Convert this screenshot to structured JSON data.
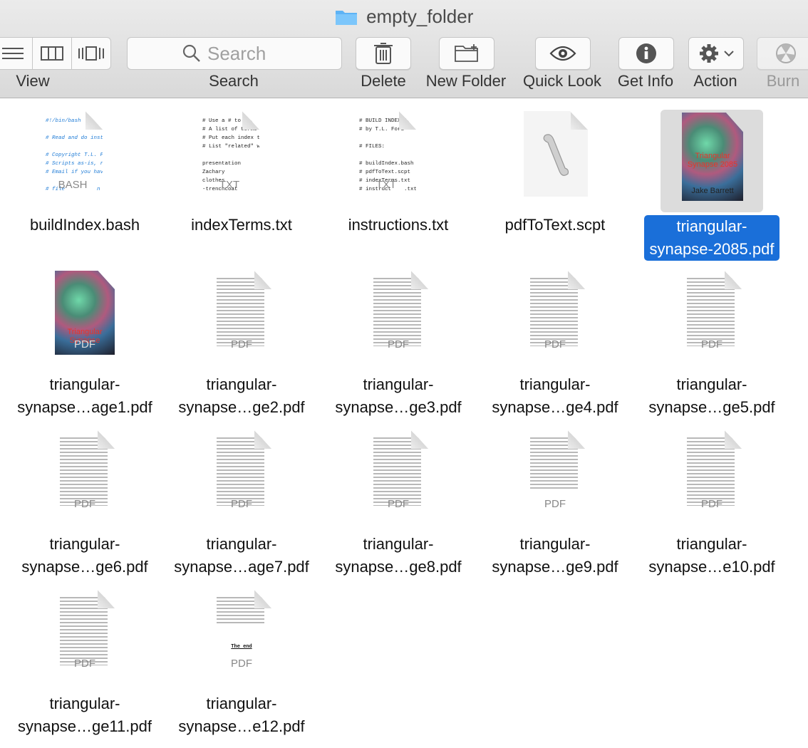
{
  "window": {
    "title": "empty_folder"
  },
  "toolbar": {
    "view_label": "View",
    "search_label": "Search",
    "search_placeholder": "Search",
    "delete_label": "Delete",
    "new_folder_label": "New Folder",
    "quick_look_label": "Quick Look",
    "get_info_label": "Get Info",
    "action_label": "Action",
    "burn_label": "Burn"
  },
  "files": [
    {
      "name": "buildIndex.bash",
      "ext": "BASH",
      "kind": "code",
      "preview": "#!/bin/bash\n\n# Read and do instruct\n\n# Copyright T.L. Ford,\n# Scripts as-is, run a\n# Email if you have sug\n\n# file          n term"
    },
    {
      "name": "indexTerms.txt",
      "ext": "TXT",
      "kind": "text",
      "preview": "# Use a # to indi\n# A list of terms\n# Put each index term\n# List \"related\" words\n\npresentation\nZachary\nclothes\n-trenchcoat"
    },
    {
      "name": "instructions.txt",
      "ext": "TXT",
      "kind": "text",
      "preview": "# BUILD INDEX TEX\n# by T.L. Ford\n\n# FILES:\n\n# buildIndex.bash\n# pdfToText.scpt\n# indexTerms.txt\n# instruct    .txt"
    },
    {
      "name": "pdfToText.scpt",
      "ext": "",
      "kind": "script"
    },
    {
      "name": "triangular-\nsynapse-2085.pdf",
      "line1": "triangular-",
      "line2": "synapse-2085.pdf",
      "ext": "",
      "kind": "cover-selected",
      "cover_text": "Triangular Synapse 2085",
      "author": "Jake Barrett"
    },
    {
      "line1": "triangular-",
      "line2": "synapse…age1.pdf",
      "ext": "PDF",
      "kind": "cover",
      "cover_text": "Triangular Synapse"
    },
    {
      "line1": "triangular-",
      "line2": "synapse…ge2.pdf",
      "ext": "PDF",
      "kind": "pdf"
    },
    {
      "line1": "triangular-",
      "line2": "synapse…ge3.pdf",
      "ext": "PDF",
      "kind": "pdf"
    },
    {
      "line1": "triangular-",
      "line2": "synapse…ge4.pdf",
      "ext": "PDF",
      "kind": "pdf"
    },
    {
      "line1": "triangular-",
      "line2": "synapse…ge5.pdf",
      "ext": "PDF",
      "kind": "pdf"
    },
    {
      "line1": "triangular-",
      "line2": "synapse…ge6.pdf",
      "ext": "PDF",
      "kind": "pdf"
    },
    {
      "line1": "triangular-",
      "line2": "synapse…age7.pdf",
      "ext": "PDF",
      "kind": "pdf"
    },
    {
      "line1": "triangular-",
      "line2": "synapse…ge8.pdf",
      "ext": "PDF",
      "kind": "pdf"
    },
    {
      "line1": "triangular-",
      "line2": "synapse…ge9.pdf",
      "ext": "PDF",
      "kind": "pdf"
    },
    {
      "line1": "triangular-",
      "line2": "synapse…e10.pdf",
      "ext": "PDF",
      "kind": "pdf"
    },
    {
      "line1": "triangular-",
      "line2": "synapse…ge11.pdf",
      "ext": "PDF",
      "kind": "pdf"
    },
    {
      "line1": "triangular-",
      "line2": "synapse…e12.pdf",
      "ext": "PDF",
      "kind": "pdf-end",
      "end_text": "The end"
    }
  ],
  "colors": {
    "selection": "#1a6fd9",
    "folder": "#5db3f5"
  }
}
